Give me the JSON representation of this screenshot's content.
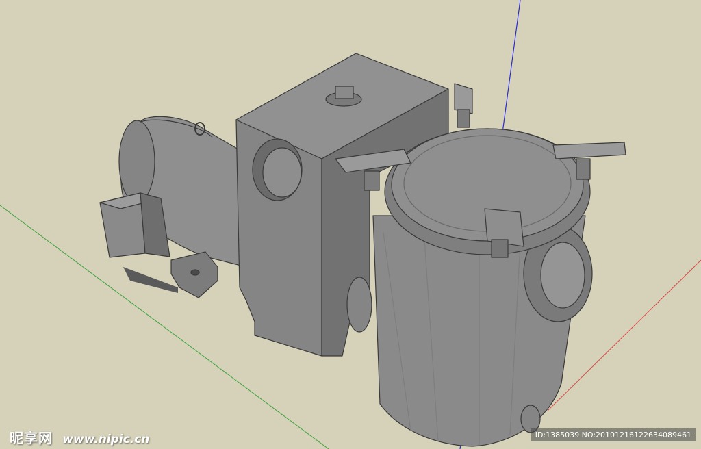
{
  "watermark": {
    "logo": "昵享网",
    "site": "www.nipic.cn",
    "id_text": "ID:1385039 NO:20101216122634089461"
  },
  "colors": {
    "background": "#d6d2ba",
    "model_light": "#8f8f8f",
    "model_mid": "#7a7a7a",
    "model_dark": "#5e5e5e",
    "edge": "#3a3a3a",
    "axis_blue": "#2a2ad8",
    "axis_green": "#3ea23e",
    "axis_red": "#d84a4a"
  },
  "icons": [
    "pump-3d-model"
  ]
}
